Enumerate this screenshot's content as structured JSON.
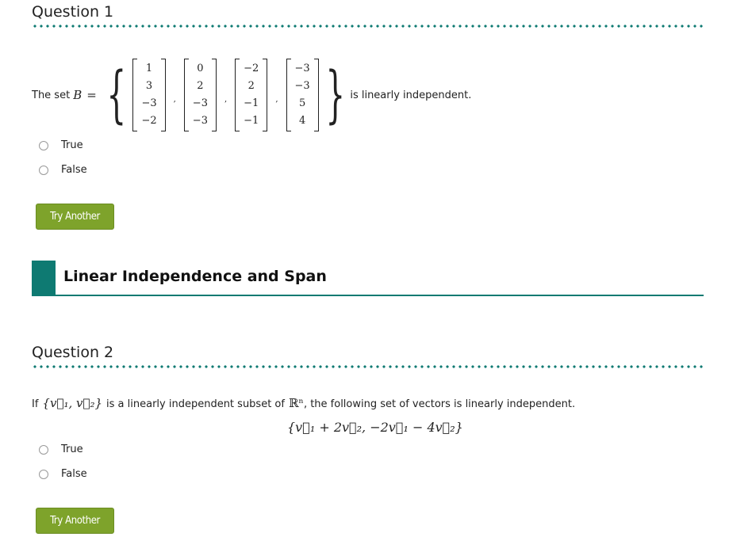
{
  "questions": [
    {
      "title": "Question 1",
      "prompt_prefix": "The set ",
      "set_symbol": "B",
      "equals": "=",
      "vectors": [
        [
          "1",
          "3",
          "−3",
          "−2"
        ],
        [
          "0",
          "2",
          "−3",
          "−3"
        ],
        [
          "−2",
          "2",
          "−1",
          "−1"
        ],
        [
          "−3",
          "−3",
          "5",
          "4"
        ]
      ],
      "prompt_suffix": "is linearly independent.",
      "options": [
        "True",
        "False"
      ],
      "button_label": "Try Another"
    },
    {
      "title": "Question 2",
      "prompt_if": "If",
      "prompt_set": "{v⃗₁, v⃗₂}",
      "prompt_middle": "is a linearly independent subset of",
      "prompt_space": "ℝⁿ",
      "prompt_end": ", the following set of vectors is linearly independent.",
      "display_math": "{v⃗₁ + 2v⃗₂,  −2v⃗₁ − 4v⃗₂}",
      "options": [
        "True",
        "False"
      ],
      "button_label": "Try Another"
    }
  ],
  "section": {
    "title": "Linear Independence and Span",
    "accent_color": "#0e7a72"
  },
  "button_color": "#7ea32b"
}
